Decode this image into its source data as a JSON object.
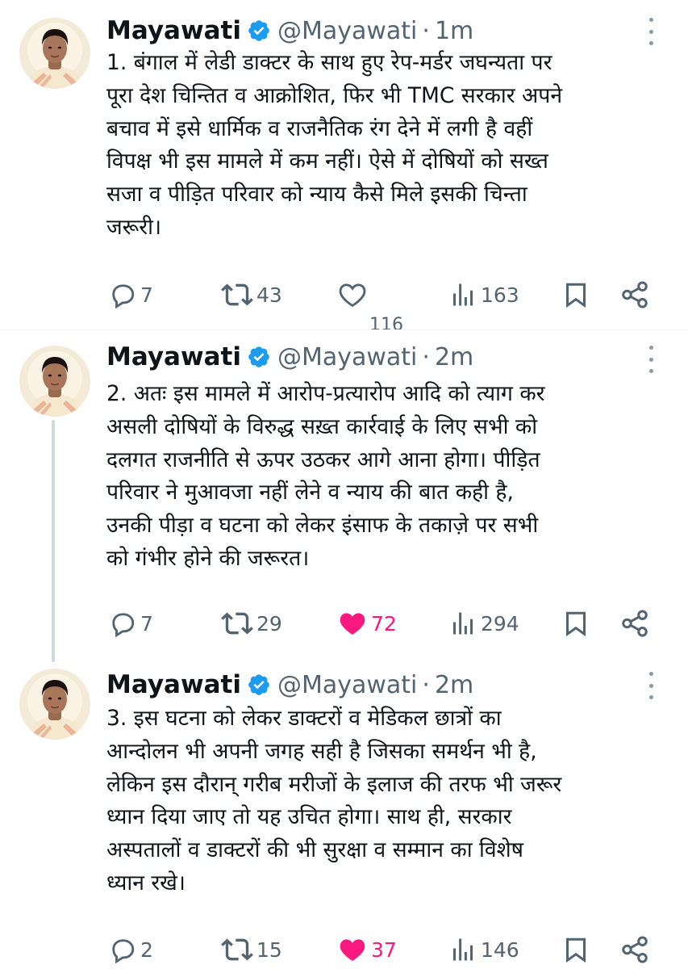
{
  "colors": {
    "text": "#0f1419",
    "muted": "#536471",
    "verified": "#1d9bf0",
    "like_active": "#f91880",
    "thread_line": "#cfd9de",
    "divider": "#eff3f4"
  },
  "icons": [
    "avatar",
    "verified-badge-icon",
    "more-icon",
    "reply-icon",
    "retweet-icon",
    "like-icon",
    "views-icon",
    "bookmark-icon",
    "share-icon"
  ],
  "tweets": [
    {
      "name": "Mayawati",
      "handle": "@Mayawati",
      "separator": "·",
      "time": "1m",
      "text": "1. बंगाल में लेडी डाक्टर के साथ हुए रेप-मर्डर जघन्यता पर\nपूरा देश चिन्तित व आक्रोशित, फिर भी TMC सरकार अपने\nबचाव में इसे धार्मिक व राजनैतिक रंग देने में लगी है वहीं\nविपक्ष भी इस मामले में कम नहीं। ऐसे में दोषियों को सख्त\nसजा व पीड़ित परिवार को न्याय कैसे मिले इसकी चिन्ता\nजरूरी।",
      "replies": "7",
      "reposts": "43",
      "likes": "116",
      "liked": false,
      "views": "163"
    },
    {
      "name": "Mayawati",
      "handle": "@Mayawati",
      "separator": "·",
      "time": "2m",
      "text": "2. अतः इस मामले में आरोप-प्रत्यारोप आदि को त्याग कर\nअसली दोषियों के विरुद्ध सख़्त कार्रवाई के लिए सभी को\nदलगत राजनीति से ऊपर उठकर आगे आना होगा। पीड़ित\nपरिवार ने मुआवजा नहीं लेने व न्याय की बात कही है,\nउनकी पीड़ा व घटना को लेकर इंसाफ के तकाज़े पर सभी\nको गंभीर होने की जरूरत।",
      "replies": "7",
      "reposts": "29",
      "likes": "72",
      "liked": true,
      "views": "294"
    },
    {
      "name": "Mayawati",
      "handle": "@Mayawati",
      "separator": "·",
      "time": "2m",
      "text": "3. इस घटना को लेकर डाक्टरों व मेडिकल छात्रों का\nआन्दोलन भी अपनी जगह सही है जिसका समर्थन भी है,\nलेकिन इस दौरान् गरीब मरीजों के इलाज की तरफ भी जरूर\nध्यान दिया जाए तो यह उचित होगा। साथ ही, सरकार\nअस्पतालों व डाक्टरों की भी सुरक्षा व सम्मान का विशेष\nध्यान रखे।",
      "replies": "2",
      "reposts": "15",
      "likes": "37",
      "liked": true,
      "views": "146"
    }
  ]
}
